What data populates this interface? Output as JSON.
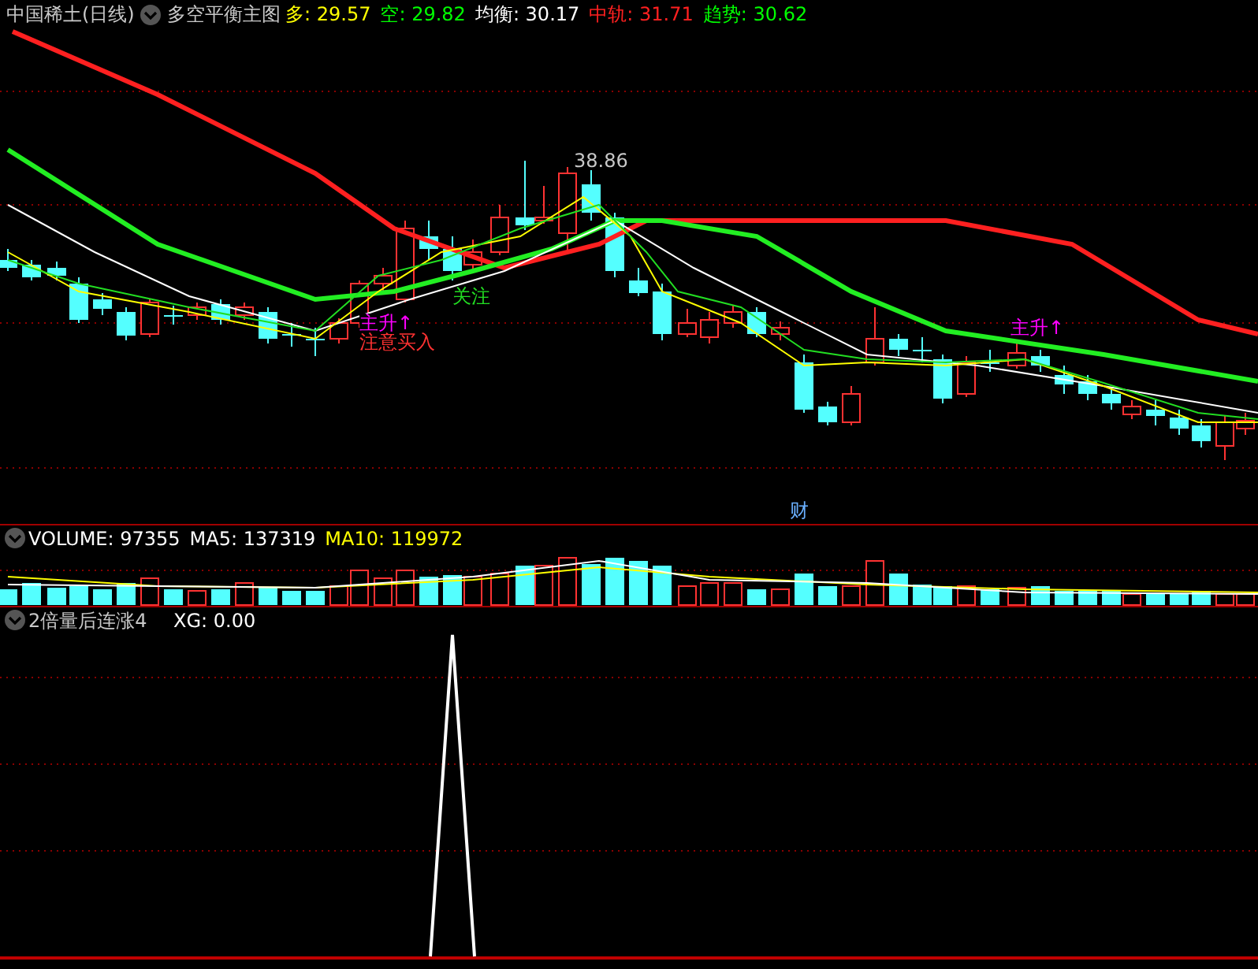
{
  "main_panel": {
    "stock_title": "中国稀土(日线)",
    "indicator_name": "多空平衡主图",
    "values": [
      {
        "label": "多:",
        "value": "29.57",
        "color": "#ffff00"
      },
      {
        "label": "空:",
        "value": "29.82",
        "color": "#00ff00"
      },
      {
        "label": "均衡:",
        "value": "30.17",
        "color": "#ffffff"
      },
      {
        "label": "中轨:",
        "value": "31.71",
        "color": "#ff2020"
      },
      {
        "label": "趋势:",
        "value": "30.62",
        "color": "#00ff00"
      }
    ],
    "annotations": [
      {
        "kind": "price",
        "text": "38.86"
      },
      {
        "kind": "signal",
        "text": "主升↑"
      },
      {
        "kind": "buy",
        "text": "注意买入"
      },
      {
        "kind": "watch",
        "text": "关注"
      },
      {
        "kind": "signal",
        "text": "主升↑"
      },
      {
        "kind": "event",
        "text": "财"
      }
    ]
  },
  "volume_panel": {
    "items": [
      {
        "label": "VOLUME:",
        "value": "97355",
        "color": "#ffffff"
      },
      {
        "label": "MA5:",
        "value": "137319",
        "color": "#ffffff"
      },
      {
        "label": "MA10:",
        "value": "119972",
        "color": "#ffff00"
      }
    ]
  },
  "indicator_panel": {
    "name": "2倍量后连涨4",
    "items": [
      {
        "label": "XG:",
        "value": "0.00",
        "color": "#ffffff"
      }
    ]
  }
}
